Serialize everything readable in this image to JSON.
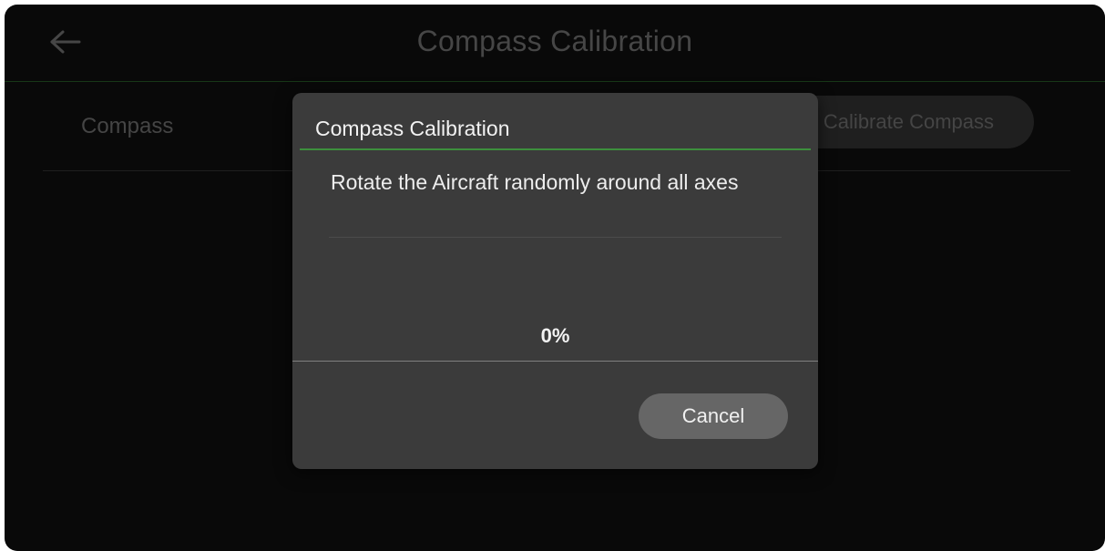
{
  "header": {
    "title": "Compass Calibration",
    "back_icon": "arrow-left-icon"
  },
  "settings_row": {
    "label": "Compass",
    "button_label": "Calibrate Compass"
  },
  "dialog": {
    "title": "Compass Calibration",
    "message": "Rotate the Aircraft randomly around all axes",
    "progress_text": "0%",
    "progress_value": 0,
    "cancel_label": "Cancel"
  },
  "colors": {
    "background": "#0c0c0c",
    "dialog": "#3b3b3b",
    "accent": "#3d8f3d",
    "button": "#666666"
  }
}
